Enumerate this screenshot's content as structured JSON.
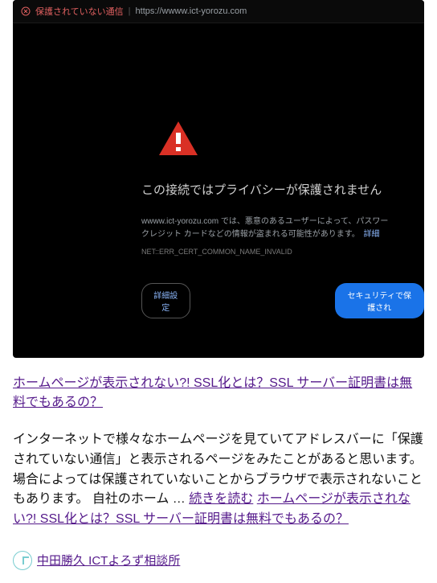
{
  "browser": {
    "insecure_label": "保護されていない通信",
    "separator": "|",
    "url": "https://wwww.ict-yorozu.com",
    "warning": {
      "title": "この接続ではプライバシーが保護されません",
      "desc_1": "wwww.ict-yorozu.com では、悪意のあるユーザーによって、パスワー",
      "desc_2": "クレジット カードなどの情報が盗まれる可能性があります。",
      "detail_link": "詳細",
      "error_code": "NET::ERR_CERT_COMMON_NAME_INVALID",
      "btn_advanced": "詳細設定",
      "btn_safe": "セキュリティで保護され"
    }
  },
  "post": {
    "title": "ホームページが表示されない?! SSL化とは？SSL サーバー証明書は無料でもあるの？",
    "excerpt": "インターネットで様々なホームページを見ていてアドレスバーに「保護されていない通信」と表示されるページをみたことがあると思います。 場合によっては保護されていないことからブラウザで表示されないこともあります。 自社のホーム … ",
    "continue_label": "続きを読む",
    "continue_title": "ホームページが表示されない?! SSL化とは？SSL サーバー証明書は無料でもあるの？"
  },
  "author": {
    "name": "中田勝久 ICTよろず相談所"
  }
}
